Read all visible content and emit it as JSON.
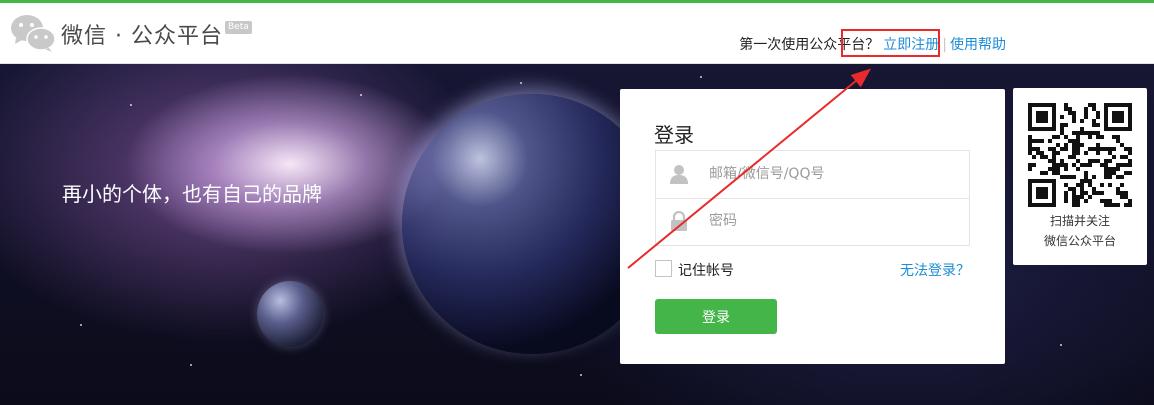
{
  "header": {
    "brand": "微信 · 公众平台",
    "beta": "Beta",
    "first_time_question": "第一次使用公众平台？",
    "register_link": "立即注册",
    "separator": "|",
    "help_link": "使用帮助"
  },
  "banner": {
    "slogan": "再小的个体，也有自己的品牌"
  },
  "login": {
    "title": "登录",
    "account_placeholder": "邮箱/微信号/QQ号",
    "password_placeholder": "密码",
    "remember_label": "记住帐号",
    "forgot_link": "无法登录？",
    "submit_label": "登录"
  },
  "qr": {
    "caption_line1": "扫描并关注",
    "caption_line2": "微信公众平台"
  },
  "colors": {
    "brand_green": "#44b549",
    "link_blue": "#1e8dd6",
    "annotation_red": "#e82a2a"
  },
  "icons": [
    "wechat-logo-icon",
    "user-icon",
    "lock-icon",
    "qr-code-icon"
  ]
}
